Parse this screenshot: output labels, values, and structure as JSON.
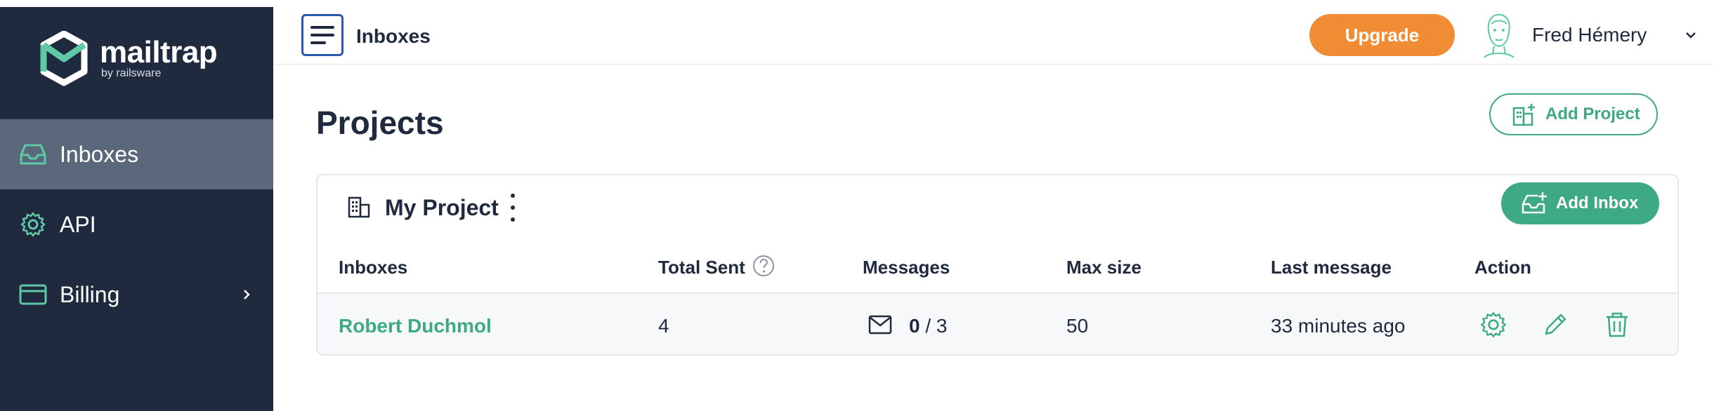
{
  "app": {
    "logo_name": "mailtrap",
    "logo_sub": "by railsware"
  },
  "sidebar": {
    "items": [
      {
        "label": "Inboxes",
        "icon": "inbox-icon",
        "active": true
      },
      {
        "label": "API",
        "icon": "gear-icon",
        "active": false
      },
      {
        "label": "Billing",
        "icon": "card-icon",
        "active": false,
        "has_submenu": true
      }
    ]
  },
  "header": {
    "title": "Inboxes",
    "upgrade_label": "Upgrade",
    "user_name": "Fred Hémery"
  },
  "main": {
    "page_title": "Projects",
    "add_project_label": "Add Project",
    "project": {
      "name": "My Project",
      "add_inbox_label": "Add Inbox",
      "columns": [
        "Inboxes",
        "Total Sent",
        "Messages",
        "Max size",
        "Last message",
        "Action"
      ],
      "rows": [
        {
          "inbox": "Robert Duchmol",
          "total_sent": "4",
          "messages_unread": "0",
          "messages_total": "/ 3",
          "max_size": "50",
          "last_message": "33 minutes ago"
        }
      ]
    }
  },
  "colors": {
    "sidebar_bg": "#1f2a3f",
    "sidebar_active": "#5b687b",
    "accent_green": "#3daa84",
    "upgrade_orange": "#f08d34"
  }
}
